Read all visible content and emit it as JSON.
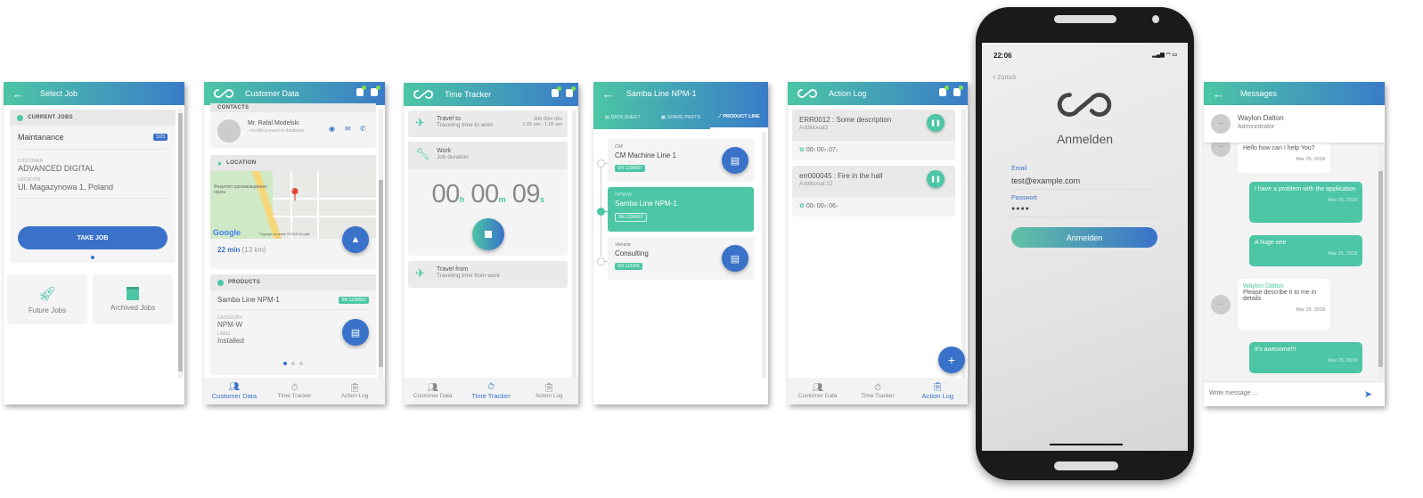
{
  "select_job": {
    "title": "Select Job",
    "section": "CURRENT JOBS",
    "job_name": "Maintanance",
    "job_badge": "1/23",
    "customer_label": "CUSTOMER",
    "customer": "ADVANCED DIGITAL",
    "location_label": "LOCATION",
    "location": "Ul. Magazynowa 1, Poland",
    "take_job": "TAKE JOB",
    "future_jobs": "Future Jobs",
    "archived_jobs": "Archived Jobs"
  },
  "customer_data": {
    "title": "Customer Data",
    "contacts_label": "CONTACTS",
    "contact_name": "Mr. Rafal Modelski",
    "contact_title": "- no title present in database -",
    "location_label": "LOCATION",
    "map_copyright": "Подаци са мапе ©2018 Google",
    "map_place": "Факултет организационих наука",
    "google": "Google",
    "travel_time": "22 min",
    "travel_distance": "(13 km)",
    "products_label": "PRODUCTS",
    "product_name": "Samba Line NPM-1",
    "product_sn": "SN 1234567",
    "category_label": "CATEGORY",
    "category": "NPM-W",
    "label_label": "LABEL",
    "label": "Installed"
  },
  "time_tracker": {
    "title": "Time Tracker",
    "travel_to": "Travel to",
    "travel_to_sub": "Traveling time to work",
    "travel_to_time": "00h 00m 05s",
    "travel_to_range": "1:05 am - 1:05 am",
    "work": "Work",
    "work_sub": "Job duration",
    "hours": "00",
    "minutes": "00",
    "seconds": "09",
    "h": "h",
    "m": "m",
    "s": "s",
    "travel_from": "Travel from",
    "travel_from_sub": "Traveling time from work"
  },
  "product_line": {
    "title": "Samba Line NPM-1",
    "tabs": [
      "DATA SHEET",
      "SPARE PARTS",
      "PRODUCT LINE"
    ],
    "items": [
      {
        "type": "CM",
        "name": "CM Machine Line 1",
        "sn": "SN 1234567"
      },
      {
        "type": "NPM-W",
        "name": "Samba Line NPM-1",
        "sn": "SN 1234567"
      },
      {
        "type": "Vehicle",
        "name": "Consulting",
        "sn": "SN 112356"
      }
    ]
  },
  "action_log": {
    "title": "Action Log",
    "entries": [
      {
        "title": "ERR0012 : Some description",
        "sub": "Additional2",
        "h": "00",
        "m": "00",
        "s": "07"
      },
      {
        "title": "err000045 : Fire in the hall",
        "sub": "Additional 22",
        "h": "00",
        "m": "00",
        "s": "06"
      }
    ]
  },
  "bottom_nav": [
    "Customer Data",
    "Time Tracker",
    "Action Log"
  ],
  "login": {
    "time": "22:06",
    "back": "Zurück",
    "title": "Anmelden",
    "email_label": "Email",
    "email": "test@example.com",
    "password_label": "Passwort",
    "password": "●●●●",
    "button": "Anmelden"
  },
  "messages": {
    "title": "Messages",
    "contact_name": "Waylon Dalton",
    "contact_role": "Administrator",
    "thread": [
      {
        "dir": "in",
        "text": "Hello how can I help You?",
        "date": "Mar 25, 2018"
      },
      {
        "dir": "out",
        "text": "I have a problem with the application",
        "date": "Mar 25, 2018"
      },
      {
        "dir": "out",
        "text": "A huge one",
        "date": "Mar 25, 2018"
      },
      {
        "dir": "in",
        "author": "Waylon Dalton",
        "text": "Please describe it to me in details",
        "date": "Mar 25, 2018"
      },
      {
        "dir": "out",
        "text": "It's awesome!!!",
        "date": "Mar 25, 2018"
      }
    ],
    "placeholder": "Write message ..."
  },
  "colors": {
    "teal": "#4cc6a5",
    "blue": "#3a72c9"
  }
}
